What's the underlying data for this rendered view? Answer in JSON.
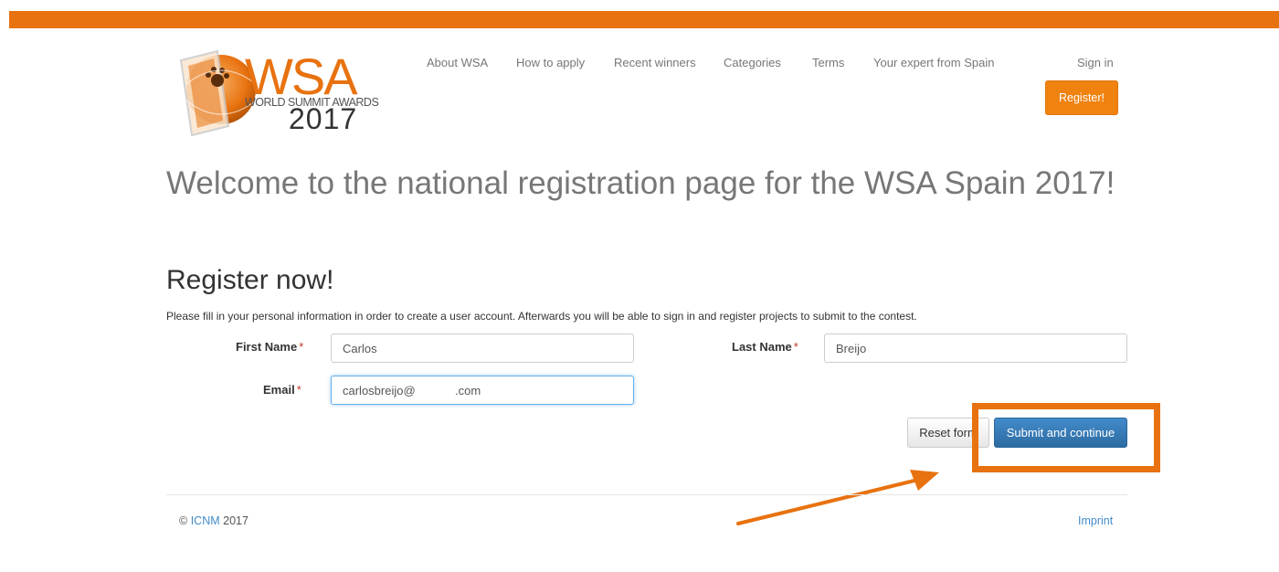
{
  "brand": {
    "logo_title": "WSA",
    "logo_subtitle": "WORLD SUMMIT AWARDS",
    "logo_year": "2017",
    "accent_color": "#e8720f"
  },
  "nav": {
    "items": [
      {
        "label": "About WSA"
      },
      {
        "label": "How to apply"
      },
      {
        "label": "Recent winners"
      },
      {
        "label": "Categories"
      },
      {
        "label": "Terms"
      },
      {
        "label": "Your expert from Spain"
      }
    ],
    "sign_in": "Sign in",
    "register": "Register!"
  },
  "welcome": "Welcome to the national registration page for the WSA Spain 2017!",
  "form": {
    "heading": "Register now!",
    "intro": "Please fill in your personal information in order to create a user account. Afterwards you will be able to sign in and register projects to submit to the contest.",
    "required_marker": "*",
    "first_name": {
      "label": "First Name",
      "value": "Carlos"
    },
    "last_name": {
      "label": "Last Name",
      "value": "Breijo"
    },
    "email": {
      "label": "Email",
      "value": "carlosbreijo@            .com"
    },
    "reset_label": "Reset form",
    "submit_label": "Submit and continue"
  },
  "footer": {
    "copyright": "© ",
    "org": "ICNM",
    "year": " 2017",
    "imprint": "Imprint"
  },
  "icons": {
    "logo": "wsa-globe-logo-icon",
    "annotation_arrow": "arrow-icon"
  }
}
